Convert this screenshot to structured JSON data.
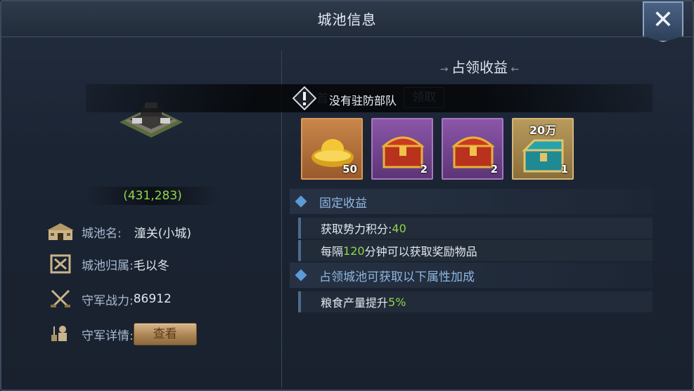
{
  "window": {
    "title": "城池信息",
    "close_icon": "close-icon"
  },
  "left": {
    "coords": "(431,283)",
    "city_name_label": "城池名:",
    "city_name_value": "潼关(小城)",
    "owner_label": "城池归属:",
    "owner_value": "毛以冬",
    "power_label": "守军战力:",
    "power_value": "86912",
    "detail_label": "守军详情:",
    "view_button": "查看"
  },
  "right": {
    "section_title": "占领收益",
    "notice": "没有驻防部队",
    "ghost_text": "首",
    "ghost_button": "领取",
    "rewards": [
      {
        "icon": "gold-ingot-icon",
        "count": "50"
      },
      {
        "icon": "red-chest-icon",
        "count": "2"
      },
      {
        "icon": "red-chest-icon",
        "count": "2"
      },
      {
        "icon": "teal-chest-icon",
        "count": "1",
        "tag": "20万"
      }
    ],
    "fixed_income": {
      "header": "固定收益",
      "line1_prefix": "获取势力积分:",
      "line1_value": "40",
      "line2_prefix": "每隔",
      "line2_value": "120",
      "line2_suffix": "分钟可以获取奖励物品"
    },
    "bonus": {
      "header": "占领城池可获取以下属性加成",
      "line1_prefix": "粮食产量提升",
      "line1_value": "5%"
    }
  },
  "colors": {
    "accent_green": "#8fd64a",
    "bullet_blue": "#5b9bd6",
    "header_text": "#8fb7e0"
  }
}
